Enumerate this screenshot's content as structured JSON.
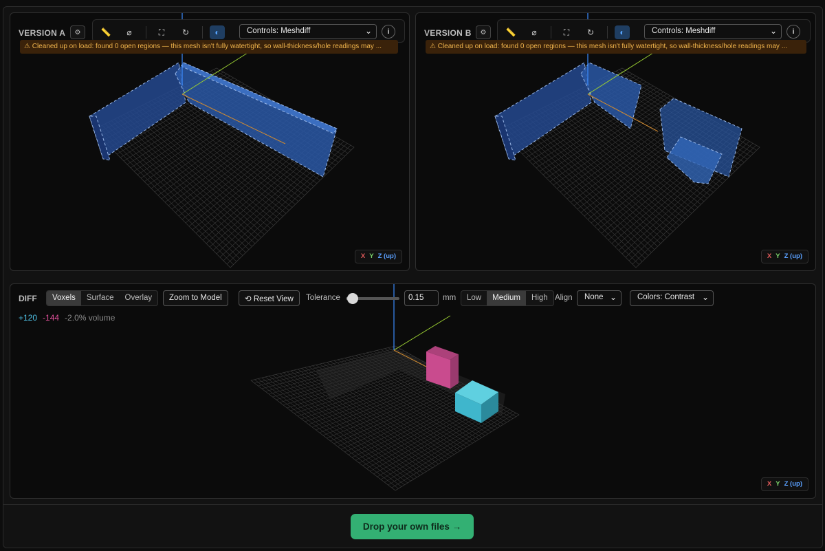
{
  "version_a": {
    "label": "VERSION A",
    "controls_select": "Controls: Meshdiff",
    "warning": "⚠ Cleaned up on load: found 0 open regions — this mesh isn't fully watertight, so wall-thickness/hole readings may ..."
  },
  "version_b": {
    "label": "VERSION B",
    "controls_select": "Controls: Meshdiff",
    "warning": "⚠ Cleaned up on load: found 0 open regions — this mesh isn't fully watertight, so wall-thickness/hole readings may ..."
  },
  "toolbar_icons": [
    "measure-icon",
    "diameter-icon",
    "fit-view-icon",
    "reset-rotate-icon",
    "contrast-toggle-icon",
    "settings-icon",
    "info-icon"
  ],
  "axes_legend": {
    "x": "X",
    "y": "Y",
    "z": "Z (up)"
  },
  "diff": {
    "label": "DIFF",
    "modes": [
      "Voxels",
      "Surface",
      "Overlay"
    ],
    "active_mode": "Voxels",
    "zoom_to_model": "Zoom to Model",
    "reset_view": "⟲ Reset View",
    "tolerance_label": "Tolerance",
    "tolerance_value": "0.15",
    "tolerance_fraction": 0.05,
    "unit": "mm",
    "quality": [
      "Low",
      "Medium",
      "High"
    ],
    "active_quality": "Medium",
    "align_label": "Align",
    "align_value": "None",
    "colors_value": "Colors: Contrast",
    "added": "+120",
    "removed": "-144",
    "volume": "-2.0% volume"
  },
  "colors": {
    "added": "#3fb6cc",
    "removed": "#c94b8e",
    "mesh": "#2a5aa8",
    "cta": "#33b073"
  },
  "cta": "Drop your own files →"
}
